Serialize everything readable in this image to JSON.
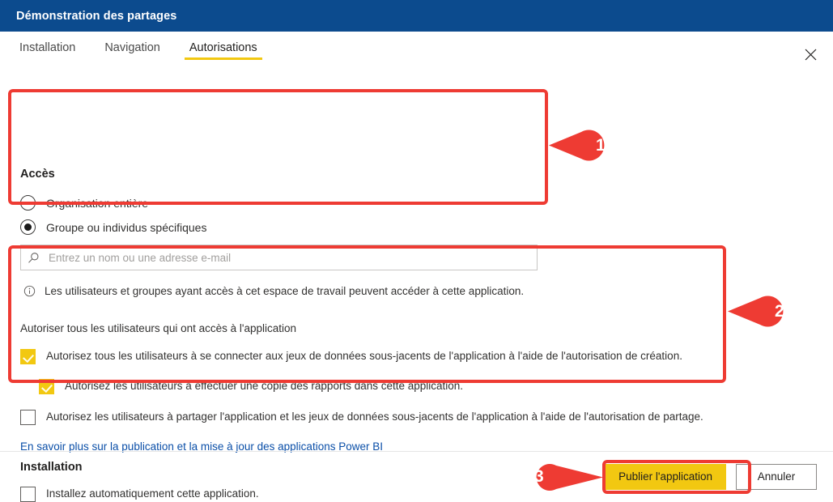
{
  "window": {
    "title": "Démonstration des partages",
    "close_icon": "close-icon"
  },
  "tabs": [
    {
      "label": "Installation",
      "active": false
    },
    {
      "label": "Navigation",
      "active": false
    },
    {
      "label": "Autorisations",
      "active": true
    }
  ],
  "access": {
    "heading": "Accès",
    "options": [
      {
        "label": "Organisation entière",
        "selected": false
      },
      {
        "label": "Groupe ou individus spécifiques",
        "selected": true
      }
    ],
    "search": {
      "placeholder": "Entrez un nom ou une adresse e-mail",
      "value": "",
      "icon": "search-icon"
    },
    "info": {
      "icon": "info-icon",
      "text": "Les utilisateurs et groupes ayant accès à cet espace de travail peuvent accéder à cette application."
    }
  },
  "permissions": {
    "heading": "Autoriser tous les utilisateurs qui ont accès à l'application",
    "checkboxes": [
      {
        "label": "Autorisez tous les utilisateurs à se connecter aux jeux de données sous-jacents de l'application à l'aide de l'autorisation de création.",
        "checked": true,
        "indented": false
      },
      {
        "label": "Autorisez les utilisateurs à effectuer une copie des rapports dans cette application.",
        "checked": true,
        "indented": true
      },
      {
        "label": "Autorisez les utilisateurs à partager l'application et les jeux de données sous-jacents de l'application à l'aide de l'autorisation de partage.",
        "checked": false,
        "indented": false
      }
    ],
    "link": "En savoir plus sur la publication et la mise à jour des applications Power BI"
  },
  "install": {
    "heading": "Installation",
    "checkbox": {
      "label": "Installez automatiquement cette application.",
      "checked": false
    }
  },
  "footer": {
    "primary_label": "Publier l'application",
    "secondary_label": "Annuler"
  },
  "annotations": {
    "markers": [
      {
        "number": "1"
      },
      {
        "number": "2"
      },
      {
        "number": "3"
      }
    ],
    "color": "#EE3B33"
  },
  "colors": {
    "header_blue": "#0C4B8E",
    "accent_yellow": "#F2C811",
    "link_blue": "#0B4FA8",
    "annotation_red": "#EE3B33"
  }
}
